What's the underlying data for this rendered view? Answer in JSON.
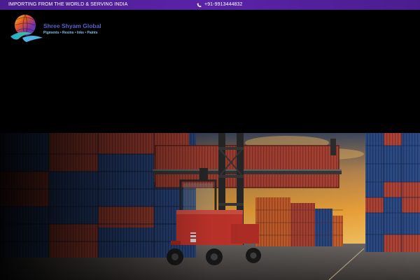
{
  "topbar": {
    "tagline": "IMPORTING FROM THE WORLD & SERVING INDIA",
    "phone": "+91-9913444832",
    "background": "#4a1d8f"
  },
  "logo": {
    "name": "Shree Shyam Global",
    "subtitle": "Pigments • Resins • Inks • Paints",
    "icon": "globe-leaf-icon"
  },
  "hero": {
    "scene": "container-port-forklift",
    "colors": {
      "sky_warm": "#f3a23a",
      "container_red": "#b8453a",
      "container_blue": "#2f4f8f",
      "forklift": "#d6392f"
    }
  }
}
